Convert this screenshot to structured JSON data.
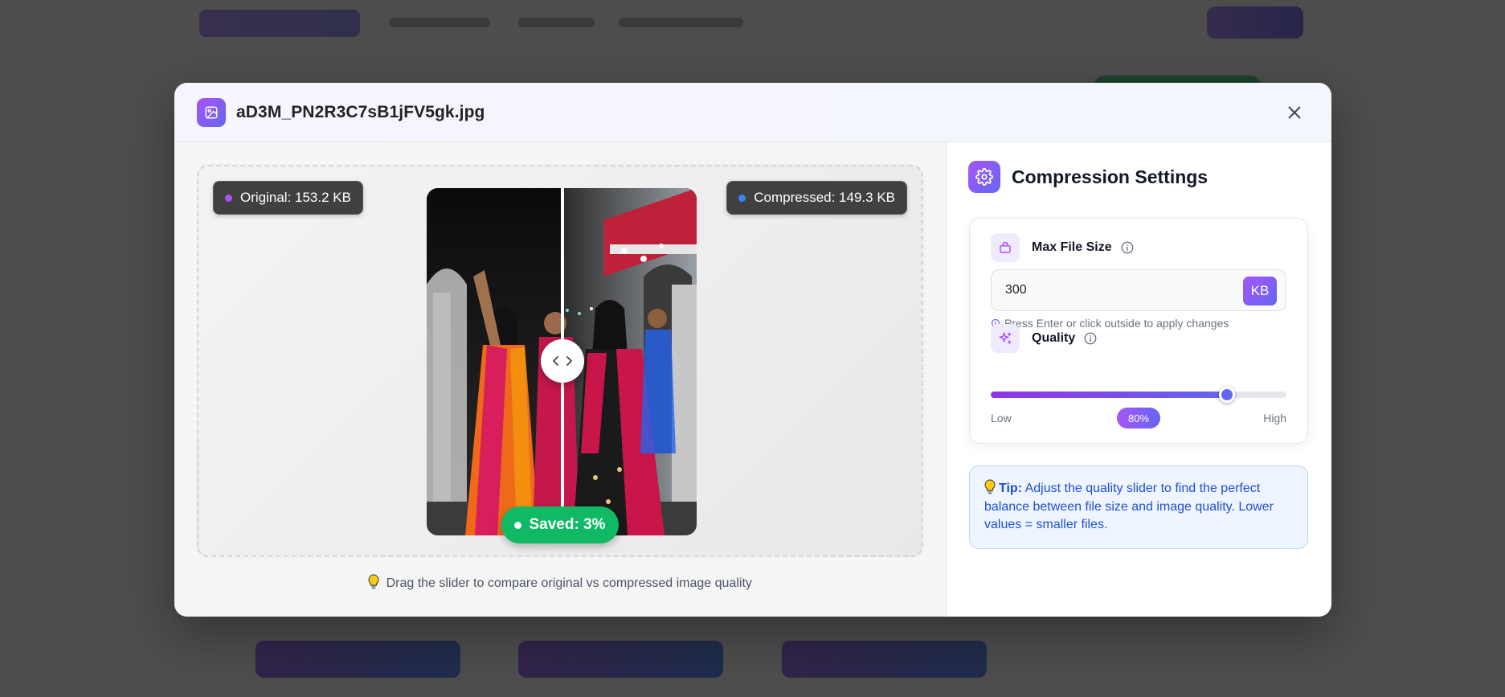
{
  "modal": {
    "title": "aD3M_PN2R3C7sB1jFV5gk.jpg"
  },
  "compare": {
    "original_label": "Original: 153.2 KB",
    "compressed_label": "Compressed: 149.3 KB",
    "saved_label": "Saved: 3%",
    "hint": "Drag the slider to compare original vs compressed image quality",
    "divider_fraction": 0.5
  },
  "settings": {
    "title": "Compression Settings",
    "max_file_size": {
      "label": "Max File Size",
      "value": "300",
      "unit": "KB",
      "apply_hint": "Press Enter or click outside to apply changes"
    },
    "quality": {
      "label": "Quality",
      "value_percent": 80,
      "value_label": "80%",
      "low_label": "Low",
      "high_label": "High"
    },
    "tip": {
      "prefix": "Tip:",
      "text": " Adjust the quality slider to find the perfect balance between file size and image quality. Lower values = smaller files."
    }
  },
  "colors": {
    "accent_purple": "#8b5cf6",
    "accent_indigo": "#6366f1",
    "original_dot": "#a855f7",
    "compressed_dot": "#3b82f6",
    "saved_green": "#10b964",
    "tip_blue": "#1d4ed8"
  },
  "icons": [
    "image-icon",
    "close-icon",
    "chevron-left-icon",
    "chevron-right-icon",
    "lightbulb-icon",
    "gear-icon",
    "weight-icon",
    "info-icon",
    "sparkles-icon"
  ]
}
